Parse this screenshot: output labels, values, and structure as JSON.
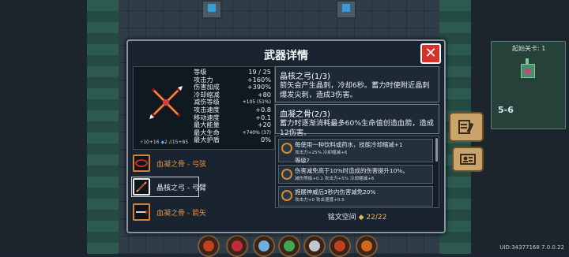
{
  "panel": {
    "title": "武器详情",
    "close_icon": "close-x-icon"
  },
  "weapon": {
    "icon": "crossed-bows-icon",
    "stats": [
      {
        "label": "等级",
        "value": "19 / 25"
      },
      {
        "label": "攻击力",
        "value": "+160%"
      },
      {
        "label": "伤害加成",
        "value": "+390%"
      },
      {
        "label": "冷却缩减",
        "value": "+80"
      },
      {
        "label": "减伤等级",
        "value": "+105 (51%)"
      },
      {
        "label": "攻击速度",
        "value": "+0.8"
      },
      {
        "label": "移动速度",
        "value": "+0.1"
      },
      {
        "label": "最大能量",
        "value": "+20"
      },
      {
        "label": "最大生命",
        "value": "+740% (37)"
      },
      {
        "label": "最大护盾",
        "value": "0%"
      }
    ],
    "mini_stats": {
      "left": "10+16",
      "mid": "2",
      "right": "15+85"
    }
  },
  "equipment": [
    {
      "label": "血凝之骨 - 弓弦",
      "selected": false,
      "icon": "bowstring-icon"
    },
    {
      "label": "晶核之弓 - 弓臂",
      "selected": true,
      "icon": "bow-limb-icon"
    },
    {
      "label": "血凝之骨 - 箭矢",
      "selected": false,
      "icon": "arrow-icon"
    }
  ],
  "descriptions": [
    {
      "title": "晶核之弓(1/3)",
      "body": "箭矢会产生晶刺，冷却6秒。蓄力时使附近晶刺爆发尖刺，造成3伤害。"
    },
    {
      "title": "血凝之骨(2/3)",
      "body": "蓄力时逐渐消耗最多60%生命值创造血箭，造成12伤害。"
    }
  ],
  "inscriptions": [
    {
      "text_main": "每使用一种饮料或药水，技能冷却缩减+1",
      "text_hl": "",
      "text_cont": "",
      "text_end": "",
      "line2": "等级?",
      "sub": "攻击力+25%  冷却缩减+6"
    },
    {
      "text_main": "伤害减免高于10%时造成的伤害提升10%。",
      "line2": "",
      "sub": "减伤等级+0.1  攻击力+5%  冷却缩减+6"
    },
    {
      "text_main": "施展神威后3秒内伤害减免20%",
      "line2": "",
      "sub": "攻击力+0  攻击速度+0.5"
    }
  ],
  "inscription_footer": {
    "label": "铭文空间",
    "count": "22/22"
  },
  "minimap": {
    "title": "起始关卡: 1",
    "level": "5-6"
  },
  "uid": "UID:34377168 7.0.0.22",
  "colors": {
    "accent_orange": "#d3803a",
    "close_red": "#d8312b",
    "count_gold": "#e3c15a"
  }
}
